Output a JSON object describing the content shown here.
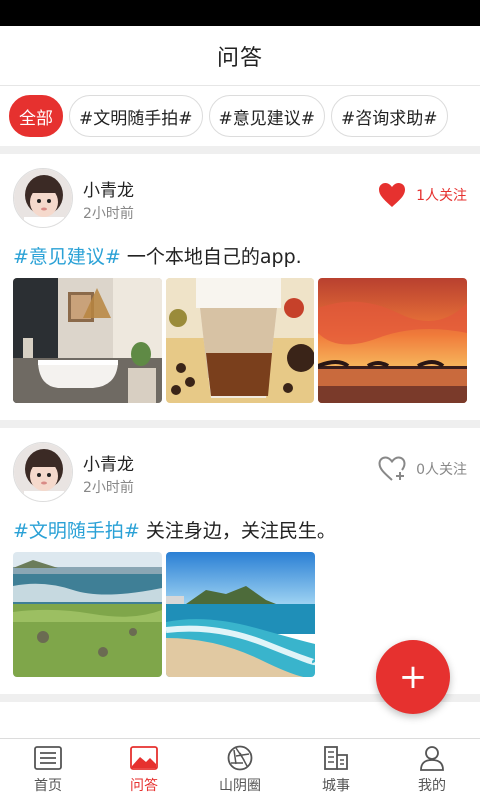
{
  "header": {
    "title": "问答"
  },
  "chips": [
    {
      "label": "全部",
      "active": true
    },
    {
      "label": "#文明随手拍#"
    },
    {
      "label": "#意见建议#"
    },
    {
      "label": "#咨询求助#"
    }
  ],
  "posts": [
    {
      "author": "小青龙",
      "time": "2小时前",
      "follow_label": "1人关注",
      "followed": true,
      "tag": "#意见建议#",
      "text": " 一个本地自己的app."
    },
    {
      "author": "小青龙",
      "time": "2小时前",
      "follow_label": "0人关注",
      "followed": false,
      "tag": "#文明随手拍#",
      "text": " 关注身边，关注民生。"
    }
  ],
  "fab": {
    "label": "+"
  },
  "tabbar": [
    {
      "label": "首页",
      "icon": "news-icon"
    },
    {
      "label": "问答",
      "icon": "image-icon",
      "active": true
    },
    {
      "label": "山阴圈",
      "icon": "aperture-icon"
    },
    {
      "label": "城事",
      "icon": "building-icon"
    },
    {
      "label": "我的",
      "icon": "person-icon"
    }
  ],
  "colors": {
    "accent": "#e6312f",
    "tag": "#2aa1d6"
  }
}
